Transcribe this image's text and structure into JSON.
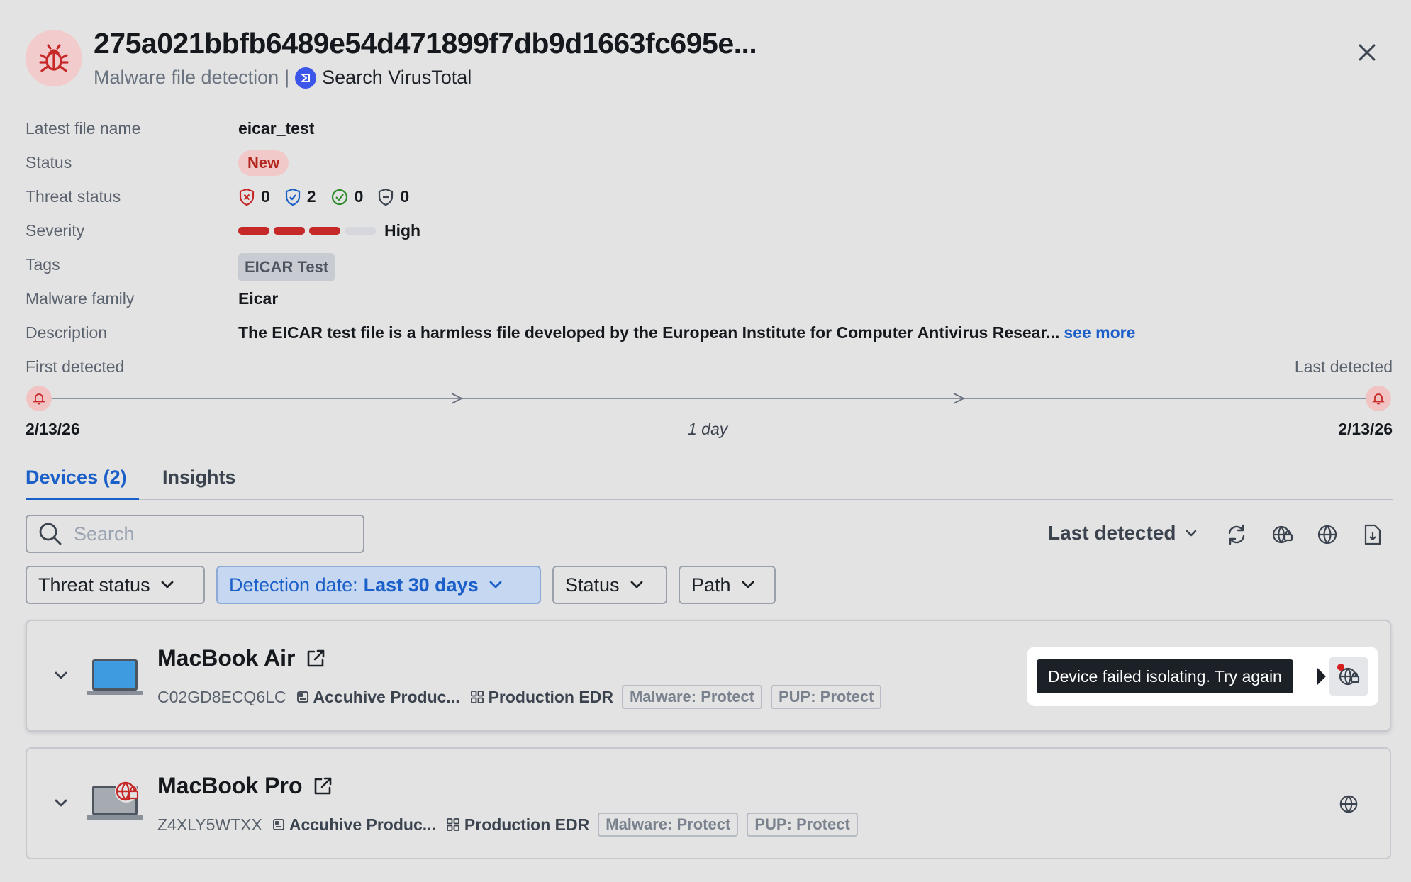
{
  "header": {
    "hash": "275a021bbfb6489e54d471899f7db9d1663fc695e...",
    "detection_type": "Malware file detection",
    "separator": "|",
    "search_link": "Search VirusTotal"
  },
  "details": {
    "latest_file_name": {
      "label": "Latest file name",
      "value": "eicar_test"
    },
    "status": {
      "label": "Status",
      "value": "New"
    },
    "threat_status": {
      "label": "Threat status",
      "counts": [
        "0",
        "2",
        "0",
        "0"
      ]
    },
    "severity": {
      "label": "Severity",
      "value": "High",
      "level": 3,
      "max": 4
    },
    "tags": {
      "label": "Tags",
      "values": [
        "EICAR Test"
      ]
    },
    "malware_family": {
      "label": "Malware family",
      "value": "Eicar"
    },
    "description": {
      "label": "Description",
      "value": "The EICAR test file is a harmless file developed by the European Institute for Computer Antivirus Resear...",
      "see_more": "see more"
    }
  },
  "timeline": {
    "first_label": "First detected",
    "last_label": "Last detected",
    "first_date": "2/13/26",
    "last_date": "2/13/26",
    "duration": "1 day"
  },
  "tabs": [
    {
      "label": "Devices (2)",
      "active": true
    },
    {
      "label": "Insights",
      "active": false
    }
  ],
  "toolbar": {
    "search_placeholder": "Search",
    "sort_label": "Last detected"
  },
  "filters": {
    "threat_status": "Threat status",
    "detection_date_label": "Detection date:",
    "detection_date_value": "Last 30 days",
    "status": "Status",
    "path": "Path"
  },
  "devices": [
    {
      "name": "MacBook Air",
      "serial": "C02GD8ECQ6LC",
      "org": "Accuhive Produc...",
      "policy_group": "Production EDR",
      "malware_policy": "Malware: Protect",
      "pup_policy": "PUP: Protect",
      "tooltip": "Device failed isolating. Try again"
    },
    {
      "name": "MacBook Pro",
      "serial": "Z4XLY5WTXX",
      "org": "Accuhive Produc...",
      "policy_group": "Production EDR",
      "malware_policy": "Malware: Protect",
      "pup_policy": "PUP: Protect"
    }
  ],
  "colors": {
    "accent": "#1b5fc9",
    "danger": "#c62828",
    "background": "#e3e3e3",
    "severity_filled": "#c62828",
    "severity_empty": "#d5d7dc"
  }
}
